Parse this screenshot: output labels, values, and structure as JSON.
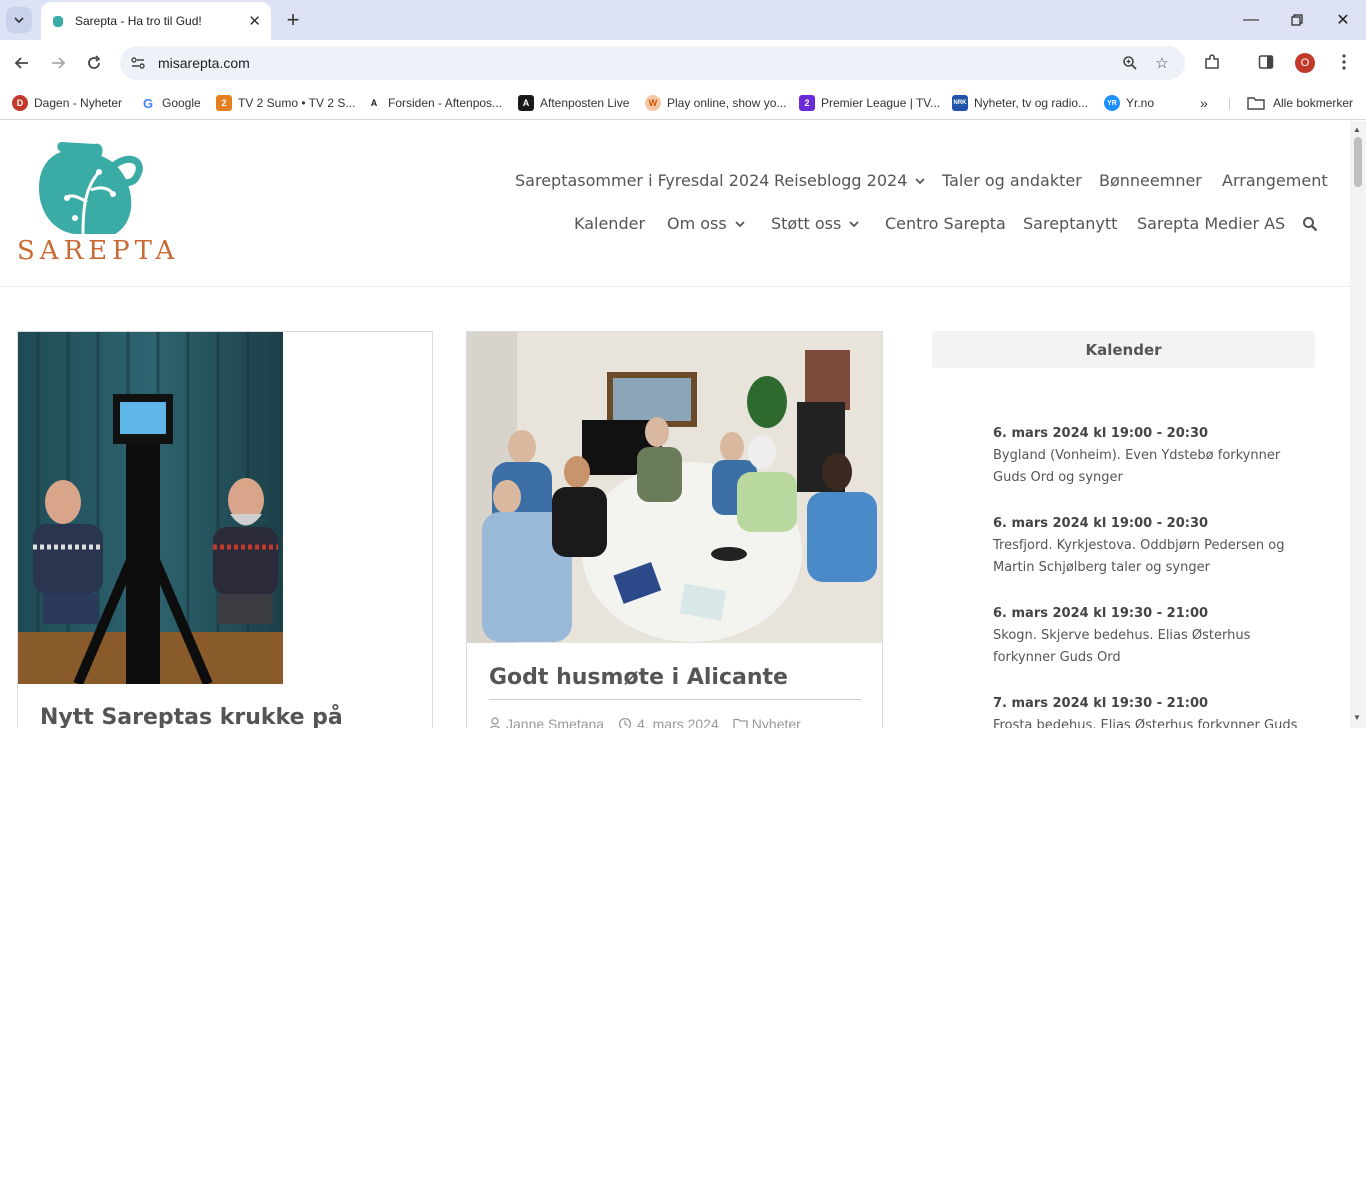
{
  "browser": {
    "tab_title": "Sarepta - Ha tro til Gud!",
    "url": "misarepta.com",
    "profile_initial": "O",
    "bookmarks": [
      {
        "label": "Dagen - Nyheter",
        "color": "#c0392b"
      },
      {
        "label": "Google",
        "color": "#4285f4"
      },
      {
        "label": "TV 2 Sumo • TV 2 S...",
        "color": "#e67e22"
      },
      {
        "label": "Forsiden - Aftenpos...",
        "color": "#1a1a1a"
      },
      {
        "label": "Aftenposten Live",
        "color": "#1a1a1a"
      },
      {
        "label": "Play online, show yo...",
        "color": "#d35400"
      },
      {
        "label": "Premier League | TV...",
        "color": "#6c2bd9"
      },
      {
        "label": "Nyheter, tv og radio...",
        "color": "#2255aa"
      },
      {
        "label": "Yr.no",
        "color": "#1e90ff"
      }
    ],
    "all_bookmarks_label": "Alle bokmerker"
  },
  "site": {
    "logo_text": "SAREPTA",
    "brand_teal": "#3aaca5",
    "brand_orange": "#c96a34",
    "menu_row1": [
      "Sareptasommer i Fyresdal 2024",
      "Reiseblogg 2024",
      "Taler og andakter",
      "Bønneemner",
      "Arrangement"
    ],
    "menu_row2": [
      "Kalender",
      "Om oss",
      "Støtt oss",
      "Centro Sarepta",
      "Sareptanytt",
      "Sarepta Medier AS"
    ]
  },
  "posts": [
    {
      "title": "Nytt Sareptas krukke på"
    },
    {
      "title": "Godt husmøte i Alicante",
      "author": "Janne Smetana",
      "date": "4. mars 2024",
      "category": "Nyheter"
    }
  ],
  "sidebar": {
    "heading": "Kalender",
    "events": [
      {
        "when": "6. mars 2024 kl 19:00 - 20:30",
        "text": "Bygland (Vonheim). Even Ydstebø forkynner Guds Ord og synger"
      },
      {
        "when": "6. mars 2024 kl 19:00 - 20:30",
        "text": "Tresfjord. Kyrkjestova. Oddbjørn Pedersen og Martin Schjølberg taler og synger"
      },
      {
        "when": "6. mars 2024 kl 19:30 - 21:00",
        "text": "Skogn. Skjerve bedehus. Elias Østerhus forkynner Guds Ord"
      },
      {
        "when": "7. mars 2024 kl 19:30 - 21:00",
        "text": "Frosta bedehus. Elias Østerhus forkynner Guds"
      }
    ]
  }
}
